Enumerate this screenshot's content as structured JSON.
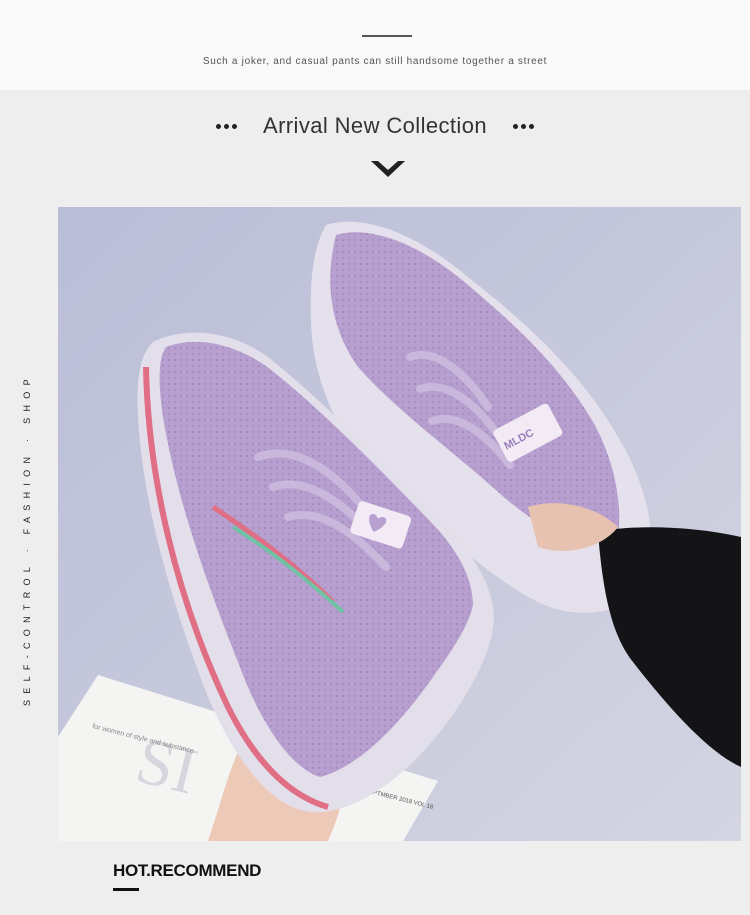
{
  "header": {
    "tagline": "Such a joker, and casual pants can still handsome together a street"
  },
  "section": {
    "title": "Arrival New Collection"
  },
  "sidebar": {
    "vertical_text": "SELF-CONTROL · FASHION · SHOP"
  },
  "product_image": {
    "shoe_logo": "MLDC",
    "magazine_title": "SI",
    "magazine_text_left": "for women of style and substance",
    "magazine_text_right": "SEPTMBER 2018 VOL 18"
  },
  "footer": {
    "hot_recommend": "HOT.RECOMMEND"
  },
  "colors": {
    "shoe": "#b9a0d0",
    "stripe_pink": "#e06f86",
    "stripe_green": "#6fc3a4",
    "backdrop": "#c6c8d9"
  }
}
